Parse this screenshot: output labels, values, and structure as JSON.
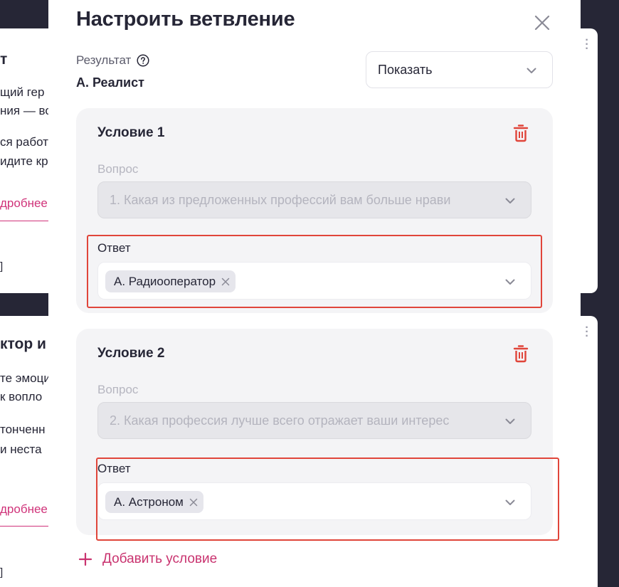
{
  "background": {
    "card1": {
      "title": "т",
      "line1": "щий гер",
      "line2": "ния — вот",
      "line3": "ся работа",
      "line4": "идите кр",
      "link": "дробнее",
      "bracket": "]"
    },
    "card2": {
      "title": "ктор и",
      "line1": "те эмоци",
      "line2": "к вопло",
      "line3": "тонченн",
      "line4": "и неста",
      "link": "дробнее",
      "bracket": "]"
    }
  },
  "modal": {
    "title": "Настроить ветвление",
    "result_label": "Результат",
    "result_value": "А. Реалист",
    "action_select": {
      "selected": "Показать"
    },
    "conditions": [
      {
        "title": "Условие 1",
        "question_label": "Вопрос",
        "question_value": "1. Какая из предложенных профессий вам больше нрави",
        "answer_label": "Ответ",
        "answer_chip": "А. Радиооператор"
      },
      {
        "title": "Условие 2",
        "question_label": "Вопрос",
        "question_value": "2. Какая профессия лучше всего отражает ваши интерес",
        "answer_label": "Ответ",
        "answer_chip": "А. Астроном"
      }
    ],
    "add_condition": "Добавить условие"
  },
  "colors": {
    "accent": "#c9336f",
    "danger": "#e0453a",
    "text": "#262636",
    "muted": "#b4b4be",
    "backdrop": "#262636"
  },
  "icons": {
    "close": "close-icon",
    "help": "question-circle-icon",
    "chevron": "chevron-down-icon",
    "trash": "trash-icon",
    "chip_remove": "x-icon",
    "add": "plus-icon"
  }
}
